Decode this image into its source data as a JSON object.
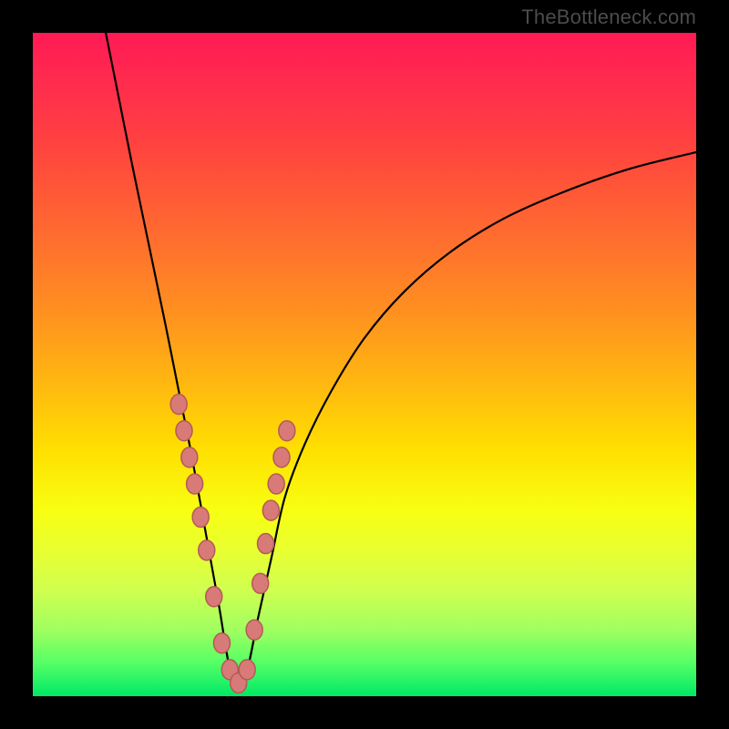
{
  "watermark": "TheBottleneck.com",
  "colors": {
    "marker_fill": "#d87a78",
    "marker_stroke": "#b35a56",
    "curve_stroke": "#000000",
    "gradient_top": "#ff1a55",
    "gradient_bottom": "#00e865",
    "frame": "#000000"
  },
  "chart_data": {
    "type": "line",
    "title": "",
    "xlabel": "",
    "ylabel": "",
    "x_range": [
      0,
      100
    ],
    "y_range": [
      0,
      100
    ],
    "note": "Axes are unlabeled in the source image; x and y are expressed as 0–100 percent of the plot area (x left→right, y bottom→top). Curve reaches a minimum near x≈30 at y≈0.",
    "series": [
      {
        "name": "bottleneck-curve",
        "x": [
          11,
          13,
          15,
          17.5,
          20,
          22,
          24,
          26,
          28,
          30,
          32,
          34,
          36,
          38,
          41,
          45,
          50,
          56,
          63,
          71,
          80,
          90,
          100
        ],
        "y": [
          100,
          90,
          80,
          68,
          56,
          46,
          36,
          25,
          14,
          3,
          3,
          12,
          21,
          30,
          38,
          46,
          54,
          61,
          67,
          72,
          76,
          79.5,
          82
        ]
      }
    ],
    "markers": {
      "name": "highlighted-points",
      "x": [
        22.0,
        22.8,
        23.6,
        24.4,
        25.3,
        26.2,
        27.3,
        28.5,
        29.7,
        31.0,
        32.3,
        33.4,
        34.3,
        35.1,
        35.9,
        36.7,
        37.5,
        38.3
      ],
      "y": [
        44,
        40,
        36,
        32,
        27,
        22,
        15,
        8,
        4,
        2,
        4,
        10,
        17,
        23,
        28,
        32,
        36,
        40
      ]
    }
  }
}
